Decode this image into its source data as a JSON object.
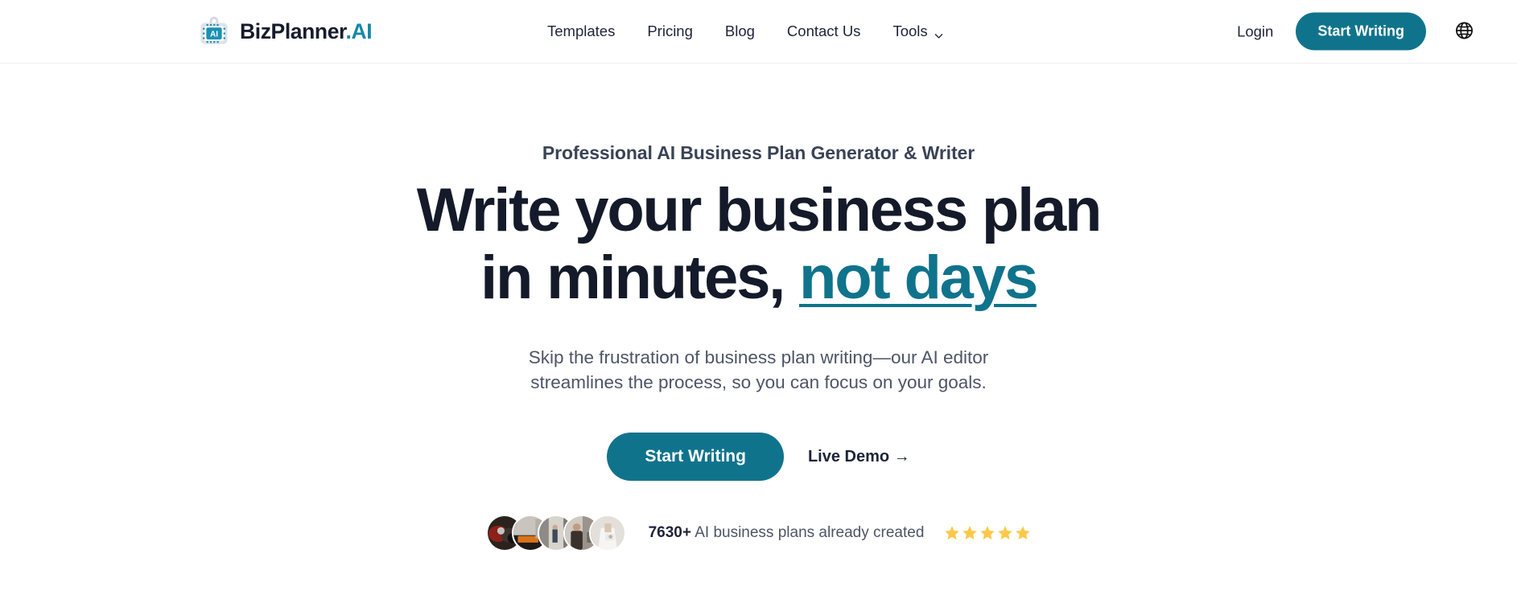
{
  "brand": {
    "name_main": "BizPlanner",
    "name_accent": ".AI",
    "logo_icon": "ai-briefcase-logo-icon",
    "logo_chip_label": "AI"
  },
  "header": {
    "nav": [
      {
        "label": "Templates",
        "icon": null
      },
      {
        "label": "Pricing",
        "icon": null
      },
      {
        "label": "Blog",
        "icon": null
      },
      {
        "label": "Contact Us",
        "icon": null
      },
      {
        "label": "Tools",
        "icon": "chevron-down-icon"
      }
    ],
    "login_label": "Login",
    "cta_label": "Start Writing",
    "language_icon": "globe-icon"
  },
  "hero": {
    "eyebrow": "Professional AI Business Plan Generator & Writer",
    "title_line1": "Write your business plan",
    "title_line2_plain": "in minutes, ",
    "title_line2_accent": "not days",
    "subtitle": "Skip the frustration of business plan writing—our AI editor streamlines the process, so you can focus on your goals.",
    "primary_cta": "Start Writing",
    "secondary_cta": "Live Demo →",
    "proof_count": "7630+",
    "proof_text": " AI business plans already created",
    "star_count": 5,
    "star_glyph": "★",
    "avatars": [
      {
        "name": "avatar-1"
      },
      {
        "name": "avatar-2"
      },
      {
        "name": "avatar-3"
      },
      {
        "name": "avatar-4"
      },
      {
        "name": "avatar-5"
      }
    ]
  },
  "colors": {
    "accent_teal": "#10738c",
    "brand_accent": "#1689a8",
    "heading_dark": "#141a29",
    "body_gray": "#4d5566",
    "star_gold": "#fbc94a",
    "header_border": "#eceef1"
  }
}
